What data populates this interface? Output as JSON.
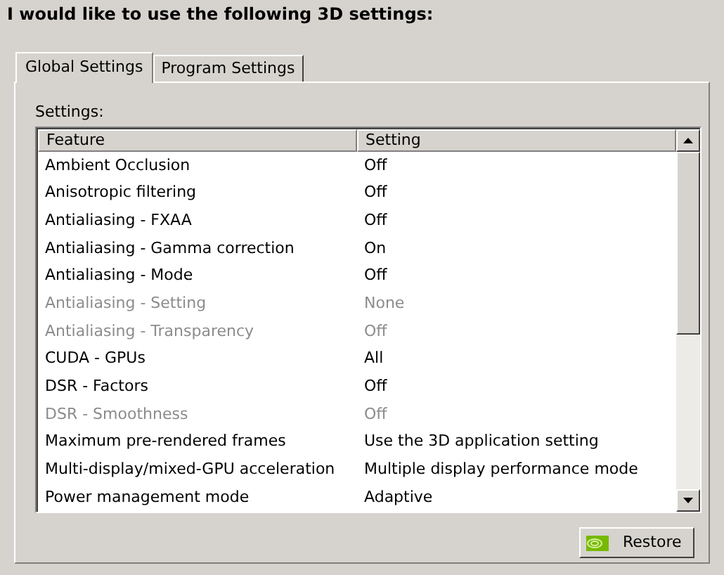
{
  "heading": "I would like to use the following 3D settings:",
  "tabs": [
    {
      "label": "Global Settings",
      "selected": true
    },
    {
      "label": "Program Settings",
      "selected": false
    }
  ],
  "settings_label": "Settings:",
  "table": {
    "columns": [
      "Feature",
      "Setting"
    ],
    "rows": [
      {
        "feature": "Ambient Occlusion",
        "setting": "Off",
        "disabled": false
      },
      {
        "feature": "Anisotropic filtering",
        "setting": "Off",
        "disabled": false
      },
      {
        "feature": "Antialiasing - FXAA",
        "setting": "Off",
        "disabled": false
      },
      {
        "feature": "Antialiasing - Gamma correction",
        "setting": "On",
        "disabled": false
      },
      {
        "feature": "Antialiasing - Mode",
        "setting": "Off",
        "disabled": false
      },
      {
        "feature": "Antialiasing - Setting",
        "setting": "None",
        "disabled": true
      },
      {
        "feature": "Antialiasing - Transparency",
        "setting": "Off",
        "disabled": true
      },
      {
        "feature": "CUDA - GPUs",
        "setting": "All",
        "disabled": false
      },
      {
        "feature": "DSR - Factors",
        "setting": "Off",
        "disabled": false
      },
      {
        "feature": "DSR - Smoothness",
        "setting": "Off",
        "disabled": true
      },
      {
        "feature": "Maximum pre-rendered frames",
        "setting": "Use the 3D application setting",
        "disabled": false
      },
      {
        "feature": "Multi-display/mixed-GPU acceleration",
        "setting": "Multiple display performance mode",
        "disabled": false
      },
      {
        "feature": "Power management mode",
        "setting": "Adaptive",
        "disabled": false
      }
    ]
  },
  "restore_button": "Restore"
}
